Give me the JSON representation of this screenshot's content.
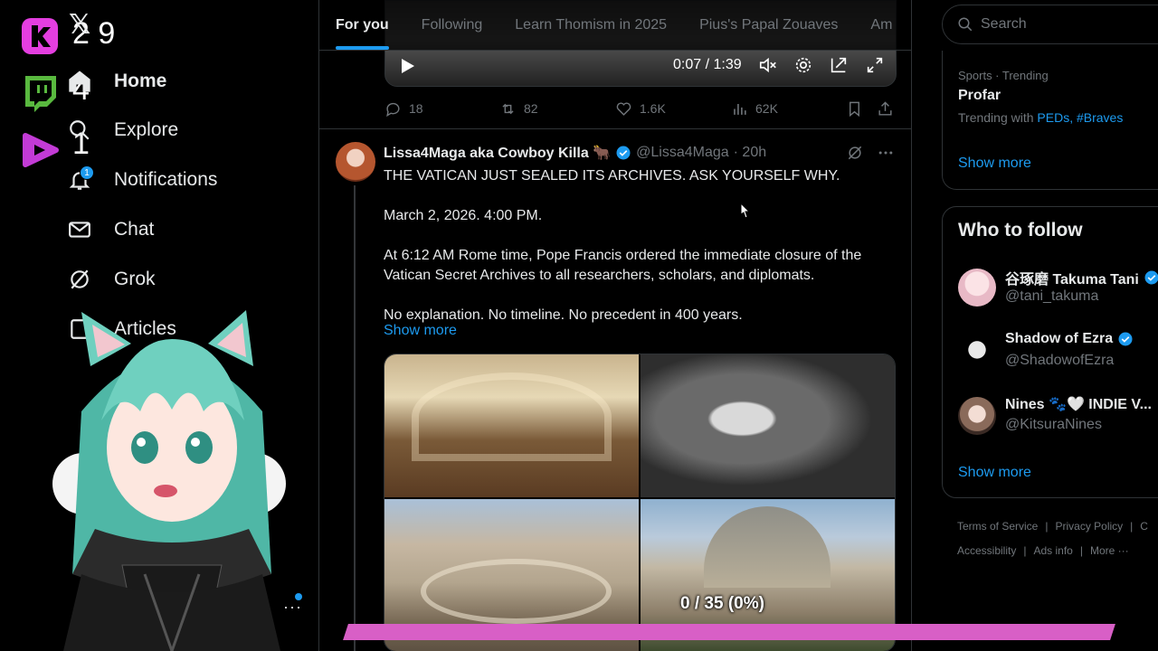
{
  "stream_overlay": {
    "kick_count": "2 9",
    "twitch_count": "4",
    "youtube_count": "1",
    "progress_label": "0 / 35 (0%)",
    "progress_fraction": 0.0,
    "accent_color": "#d85fc6"
  },
  "nav": {
    "logo": "𝕏",
    "items": [
      {
        "label": "Home",
        "icon": "home-icon"
      },
      {
        "label": "Explore",
        "icon": "search-icon"
      },
      {
        "label": "Notifications",
        "icon": "bell-icon",
        "badge": "1"
      },
      {
        "label": "Chat",
        "icon": "mail-icon"
      },
      {
        "label": "Grok",
        "icon": "grok-icon"
      },
      {
        "label": "Articles",
        "icon": "articles-icon"
      }
    ],
    "more": "···"
  },
  "tabs": [
    "For you",
    "Following",
    "Learn Thomism in 2025",
    "Pius's Papal Zouaves",
    "Am"
  ],
  "video": {
    "time": "0:07 / 1:39"
  },
  "prev_actions": {
    "replies": "18",
    "reposts": "82",
    "likes": "1.6K",
    "views": "62K"
  },
  "tweet": {
    "name": "Lissa4Maga aka Cowboy Killa 🐂",
    "handle": "@Lissa4Maga",
    "time": "· 20h",
    "lines": [
      "THE VATICAN JUST SEALED ITS ARCHIVES. ASK YOURSELF WHY.",
      "March 2, 2026. 4:00 PM.",
      "At 6:12 AM Rome time, Pope Francis ordered the immediate closure of the Vatican Secret Archives to all researchers, scholars, and diplomats.",
      "No explanation. No timeline. No precedent in 400 years."
    ],
    "show_more": "Show more"
  },
  "search": {
    "placeholder": "Search"
  },
  "trend": {
    "meta": "Sports · Trending",
    "title": "Profar",
    "with_prefix": "Trending with ",
    "links": "PEDs, #Braves",
    "show_more": "Show more"
  },
  "who_to_follow": {
    "title": "Who to follow",
    "people": [
      {
        "name": "谷琢磨 Takuma Tani",
        "handle": "@tani_takuma",
        "verified": true
      },
      {
        "name": "Shadow of Ezra",
        "handle": "@ShadowofEzra",
        "verified": true
      },
      {
        "name": "Nines 🐾🤍 INDIE V...",
        "handle": "@KitsuraNines",
        "verified": false
      }
    ],
    "show_more": "Show more"
  },
  "footer": {
    "row1": [
      "Terms of Service",
      "Privacy Policy",
      "C"
    ],
    "row2": [
      "Accessibility",
      "Ads info",
      "More ···"
    ]
  },
  "colors": {
    "link": "#1d9bf0",
    "muted": "#71767b",
    "border": "#2f3336",
    "text": "#e7e9ea"
  }
}
